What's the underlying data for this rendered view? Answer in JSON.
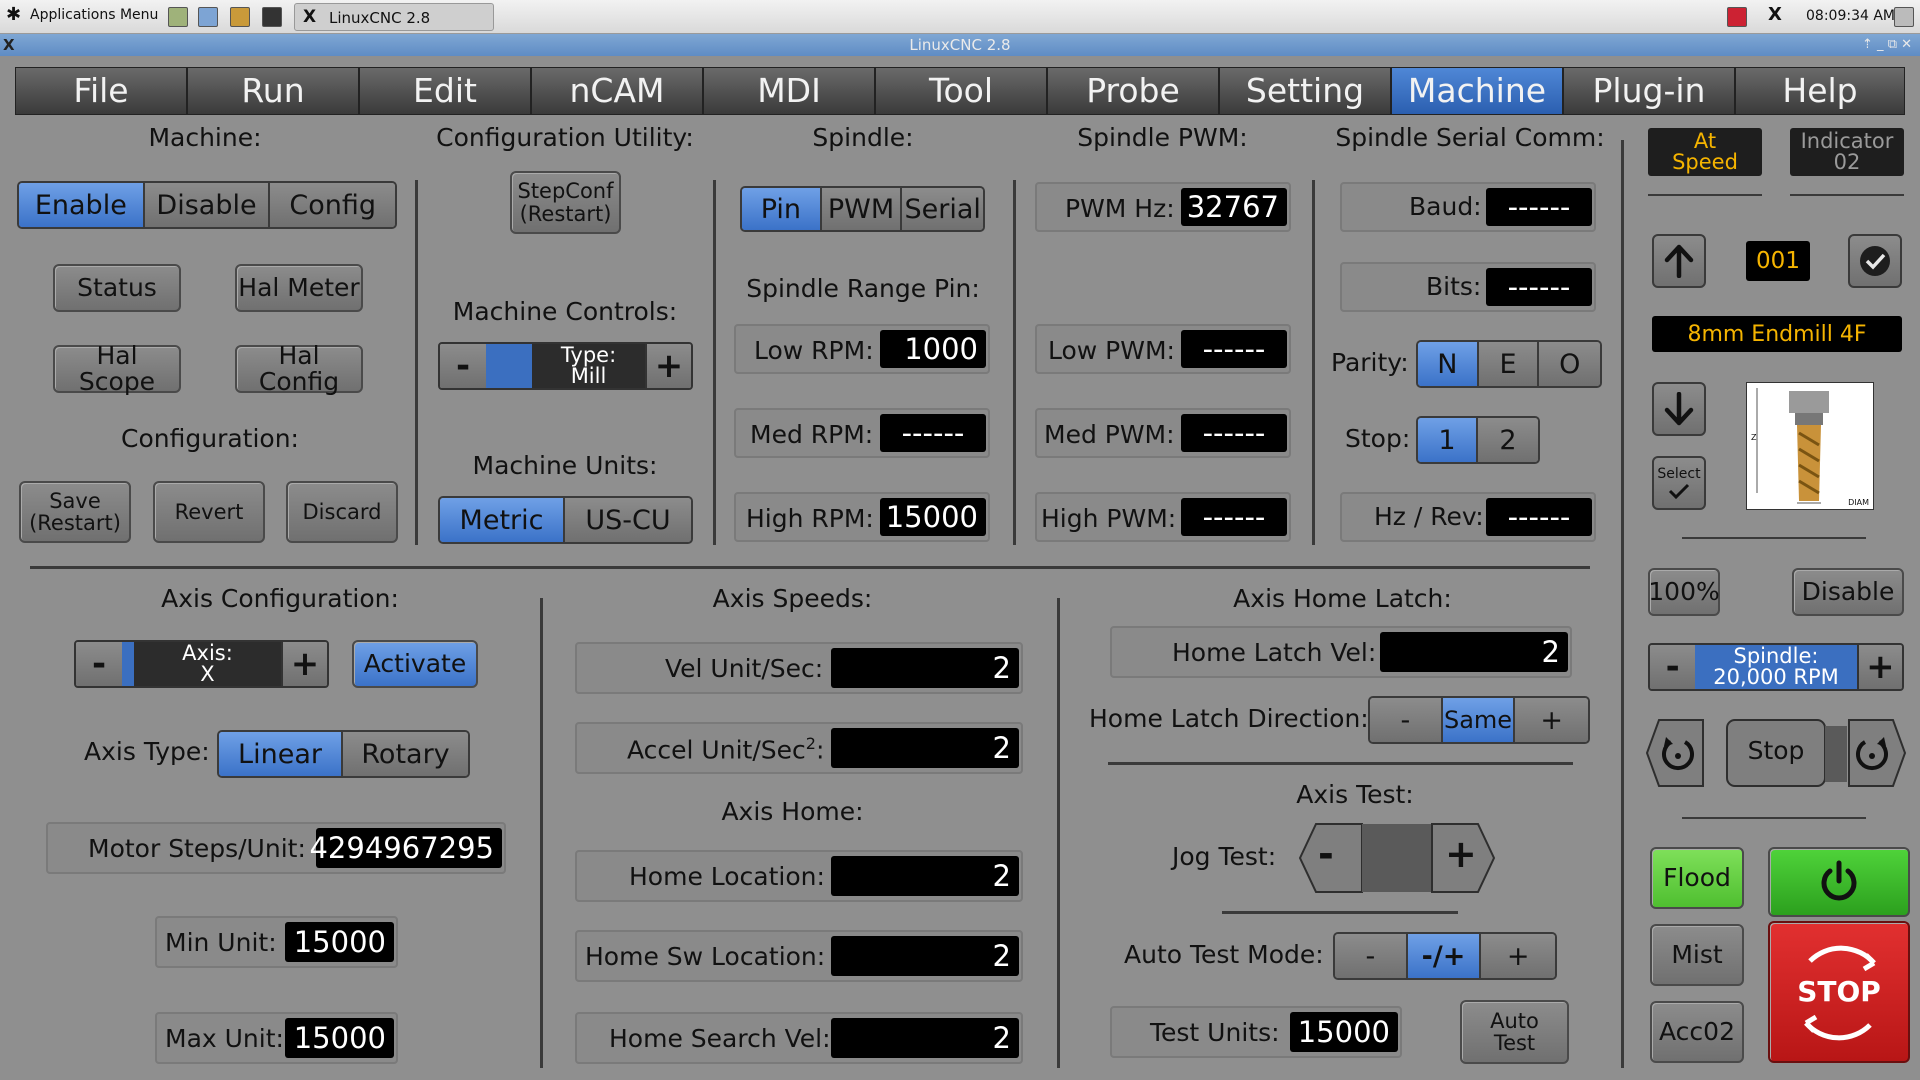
{
  "taskbar": {
    "apps_menu": "Applications Menu",
    "window_tab": "LinuxCNC 2.8",
    "clock": "08:09:34 AM"
  },
  "window": {
    "title": "LinuxCNC 2.8"
  },
  "menu": [
    "File",
    "Run",
    "Edit",
    "nCAM",
    "MDI",
    "Tool",
    "Probe",
    "Setting",
    "Machine",
    "Plug-in",
    "Help"
  ],
  "machine": {
    "title": "Machine:",
    "enable": "Enable",
    "disable": "Disable",
    "config": "Config",
    "status": "Status",
    "hal_meter": "Hal Meter",
    "hal_scope": "Hal Scope",
    "hal_config": "Hal Config",
    "configuration_title": "Configuration:",
    "save": "Save\n(Restart)",
    "revert": "Revert",
    "discard": "Discard"
  },
  "config_utility": {
    "title": "Configuration Utility:",
    "stepconf": "StepConf\n(Restart)",
    "controls_title": "Machine Controls:",
    "type_label": "Type:",
    "type_value": "Mill",
    "units_title": "Machine Units:",
    "metric": "Metric",
    "uscu": "US-CU"
  },
  "spindle": {
    "title": "Spindle:",
    "pin": "Pin",
    "pwm": "PWM",
    "serial": "Serial",
    "range_title": "Spindle Range Pin:",
    "low_label": "Low RPM:",
    "low_value": "1000",
    "med_label": "Med RPM:",
    "med_value": "------",
    "high_label": "High RPM:",
    "high_value": "15000"
  },
  "spindle_pwm": {
    "title": "Spindle PWM:",
    "hz_label": "PWM Hz:",
    "hz_value": "32767",
    "low_label": "Low PWM:",
    "low_value": "------",
    "med_label": "Med PWM:",
    "med_value": "------",
    "high_label": "High PWM:",
    "high_value": "------"
  },
  "serial": {
    "title": "Spindle Serial Comm:",
    "baud_label": "Baud:",
    "baud_value": "------",
    "bits_label": "Bits:",
    "bits_value": "------",
    "parity_label": "Parity:",
    "parity_options": [
      "N",
      "E",
      "O"
    ],
    "stop_label": "Stop:",
    "stop_options": [
      "1",
      "2"
    ],
    "hzrev_label": "Hz / Rev:",
    "hzrev_value": "------"
  },
  "axis_config": {
    "title": "Axis Configuration:",
    "axis_label": "Axis:",
    "axis_value": "X",
    "activate": "Activate",
    "type_label": "Axis Type:",
    "linear": "Linear",
    "rotary": "Rotary",
    "steps_label": "Motor Steps/Unit:",
    "steps_value": "4294967295",
    "min_label": "Min Unit:",
    "min_value": "15000",
    "max_label": "Max Unit:",
    "max_value": "15000"
  },
  "axis_speeds": {
    "title": "Axis Speeds:",
    "vel_label": "Vel Unit/Sec:",
    "vel_value": "2",
    "accel_label": "Accel Unit/Sec",
    "accel_sup": "2",
    "accel_colon": ":",
    "accel_value": "2",
    "home_title": "Axis Home:",
    "home_loc_label": "Home Location:",
    "home_loc_value": "2",
    "home_sw_label": "Home Sw Location:",
    "home_sw_value": "2",
    "home_search_label": "Home Search Vel:",
    "home_search_value": "2"
  },
  "home_latch": {
    "title": "Axis Home Latch:",
    "vel_label": "Home Latch Vel:",
    "vel_value": "2",
    "dir_label": "Home Latch Direction:",
    "dir_minus": "-",
    "dir_value": "Same",
    "dir_plus": "+",
    "test_title": "Axis Test:",
    "jog_label": "Jog Test:",
    "jog_minus": "-",
    "jog_plus": "+",
    "auto_label": "Auto Test Mode:",
    "auto_minus": "-",
    "auto_value": "-/+",
    "auto_plus": "+",
    "units_label": "Test Units:",
    "units_value": "15000",
    "auto_test": "Auto\nTest"
  },
  "right_panel": {
    "at_speed": "At\nSpeed",
    "indicator": "Indicator\n02",
    "tool_number": "001",
    "tool_name": "8mm Endmill 4F",
    "select": "Select",
    "percent": "100%",
    "disable": "Disable",
    "spindle_label": "Spindle:",
    "spindle_value": "20,000 RPM",
    "stop": "Stop",
    "flood": "Flood",
    "mist": "Mist",
    "acc": "Acc02",
    "estop": "STOP",
    "tool_image_labels": {
      "z": "Z",
      "diam": "DIAM"
    }
  },
  "colors": {
    "accent": "#3b72c8",
    "flood": "#5fcf3a",
    "power": "#35b52a",
    "estop": "#d42020",
    "amber": "#f5b400"
  }
}
